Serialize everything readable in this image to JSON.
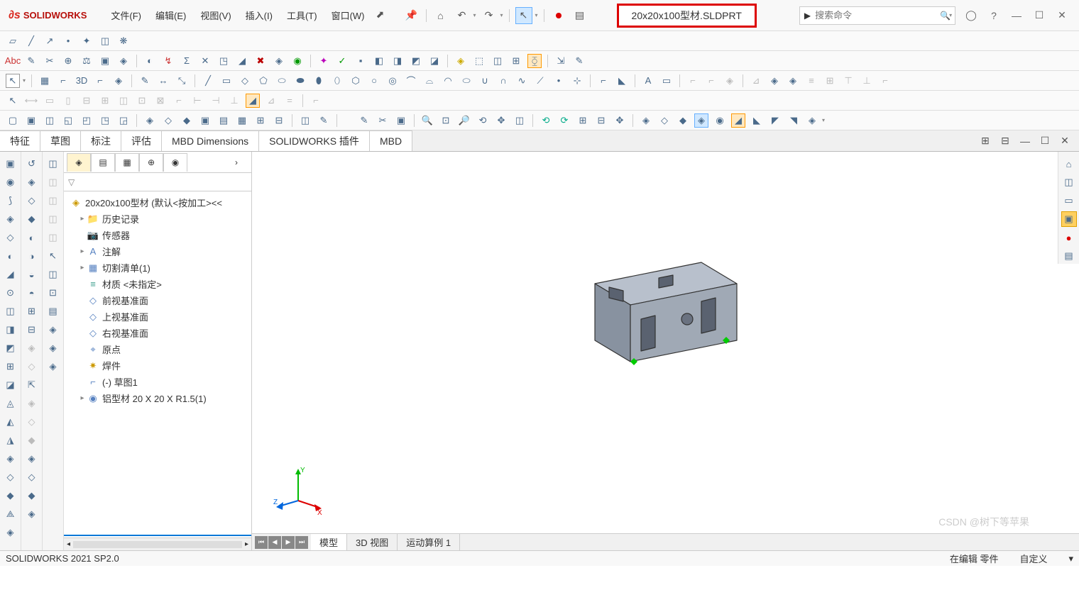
{
  "app": {
    "name": "SOLIDWORKS"
  },
  "menu": [
    "文件(F)",
    "编辑(E)",
    "视图(V)",
    "插入(I)",
    "工具(T)",
    "窗口(W)"
  ],
  "doc_title": "20x20x100型材.SLDPRT",
  "search": {
    "placeholder": "搜索命令"
  },
  "cmd_tabs": [
    "特征",
    "草图",
    "标注",
    "评估",
    "MBD Dimensions",
    "SOLIDWORKS 插件",
    "MBD"
  ],
  "tree": {
    "root": "20x20x100型材  (默认<按加工><<",
    "items": [
      {
        "label": "历史记录",
        "icon": "📁",
        "expand": "▸"
      },
      {
        "label": "传感器",
        "icon": "📷",
        "expand": ""
      },
      {
        "label": "注解",
        "icon": "A",
        "expand": "▸"
      },
      {
        "label": "切割清单(1)",
        "icon": "▦",
        "expand": "▸"
      },
      {
        "label": "材质 <未指定>",
        "icon": "≡",
        "expand": ""
      },
      {
        "label": "前视基准面",
        "icon": "◇",
        "expand": ""
      },
      {
        "label": "上视基准面",
        "icon": "◇",
        "expand": ""
      },
      {
        "label": "右视基准面",
        "icon": "◇",
        "expand": ""
      },
      {
        "label": "原点",
        "icon": "⌖",
        "expand": ""
      },
      {
        "label": "焊件",
        "icon": "✷",
        "expand": ""
      },
      {
        "label": "(-) 草图1",
        "icon": "⌐",
        "expand": ""
      },
      {
        "label": "铝型材 20 X 20 X R1.5(1)",
        "icon": "◉",
        "expand": "▸"
      }
    ]
  },
  "view_tabs": [
    "模型",
    "3D 视图",
    "运动算例 1"
  ],
  "status": {
    "left": "SOLIDWORKS 2021 SP2.0",
    "mid": "在编辑 零件",
    "right": "自定义"
  },
  "watermark": "CSDN @树下等苹果",
  "axis": {
    "x": "X",
    "y": "Y",
    "z": "Z"
  }
}
